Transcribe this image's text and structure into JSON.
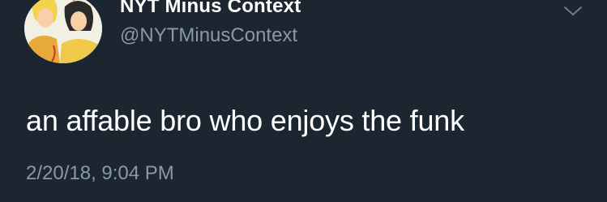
{
  "tweet": {
    "author": {
      "display_name": "NYT Minus Context",
      "handle": "@NYTMinusContext",
      "avatar_icon": "cartoon-avatar"
    },
    "menu_icon": "chevron-down-icon",
    "text": "an affable bro who enjoys the funk",
    "timestamp": "2/20/18, 9:04 PM"
  },
  "colors": {
    "background": "#1b2631",
    "primary_text": "#ffffff",
    "secondary_text": "#8b98a5"
  }
}
